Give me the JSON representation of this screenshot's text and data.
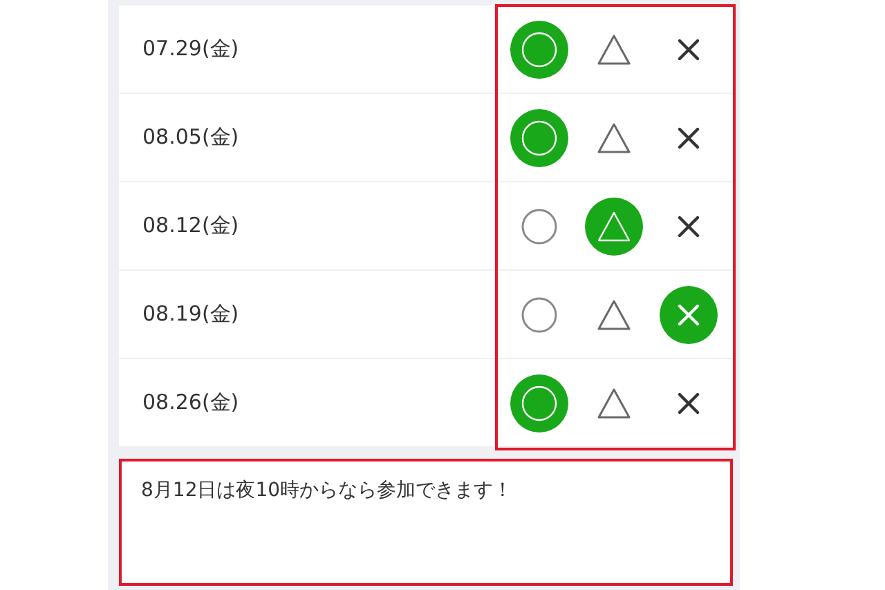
{
  "rows": [
    {
      "date": "07.29(金)",
      "options": [
        {
          "kind": "yes",
          "selected": true
        },
        {
          "kind": "maybe",
          "selected": false
        },
        {
          "kind": "no",
          "selected": false
        }
      ]
    },
    {
      "date": "08.05(金)",
      "options": [
        {
          "kind": "yes",
          "selected": true
        },
        {
          "kind": "maybe",
          "selected": false
        },
        {
          "kind": "no",
          "selected": false
        }
      ]
    },
    {
      "date": "08.12(金)",
      "options": [
        {
          "kind": "yes",
          "selected": false
        },
        {
          "kind": "maybe",
          "selected": true
        },
        {
          "kind": "no",
          "selected": false
        }
      ]
    },
    {
      "date": "08.19(金)",
      "options": [
        {
          "kind": "yes",
          "selected": false
        },
        {
          "kind": "maybe",
          "selected": false
        },
        {
          "kind": "no",
          "selected": true
        }
      ]
    },
    {
      "date": "08.26(金)",
      "options": [
        {
          "kind": "yes",
          "selected": true
        },
        {
          "kind": "maybe",
          "selected": false
        },
        {
          "kind": "no",
          "selected": false
        }
      ]
    }
  ],
  "comment": {
    "value": "8月12日は夜10時からなら参加できます！"
  }
}
